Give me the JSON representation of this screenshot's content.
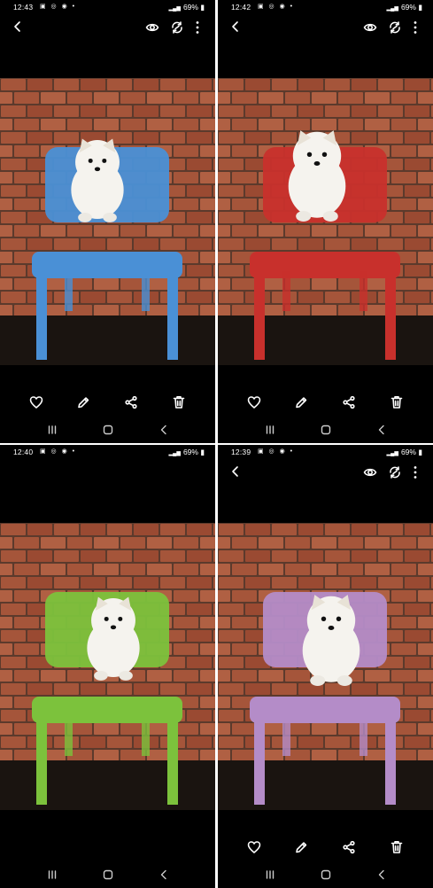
{
  "panels": [
    {
      "time": "12:43",
      "battery": "69%",
      "chair": "blue",
      "show_top_actions": true,
      "show_bottom_actions": true
    },
    {
      "time": "12:42",
      "battery": "69%",
      "chair": "red",
      "show_top_actions": true,
      "show_bottom_actions": true
    },
    {
      "time": "12:40",
      "battery": "69%",
      "chair": "green",
      "show_top_actions": false,
      "show_bottom_actions": false
    },
    {
      "time": "12:39",
      "battery": "69%",
      "chair": "purple",
      "show_top_actions": true,
      "show_bottom_actions": true
    }
  ],
  "colors": {
    "blue_chair": "#4a90d6",
    "red_chair": "#c8302c",
    "green_chair": "#7cc23c",
    "purple_chair": "#b48cc8",
    "brick": "#a5553a",
    "mortar": "#5c3a2c",
    "floor": "#1a1410",
    "puppy": "#f5f3ee"
  },
  "icons": {
    "top": [
      "back-icon",
      "eye-icon",
      "remaster-icon",
      "more-icon"
    ],
    "actions": [
      "heart-icon",
      "pencil-icon",
      "share-icon",
      "trash-icon"
    ],
    "nav": [
      "recents-icon",
      "home-icon",
      "back-icon"
    ]
  }
}
